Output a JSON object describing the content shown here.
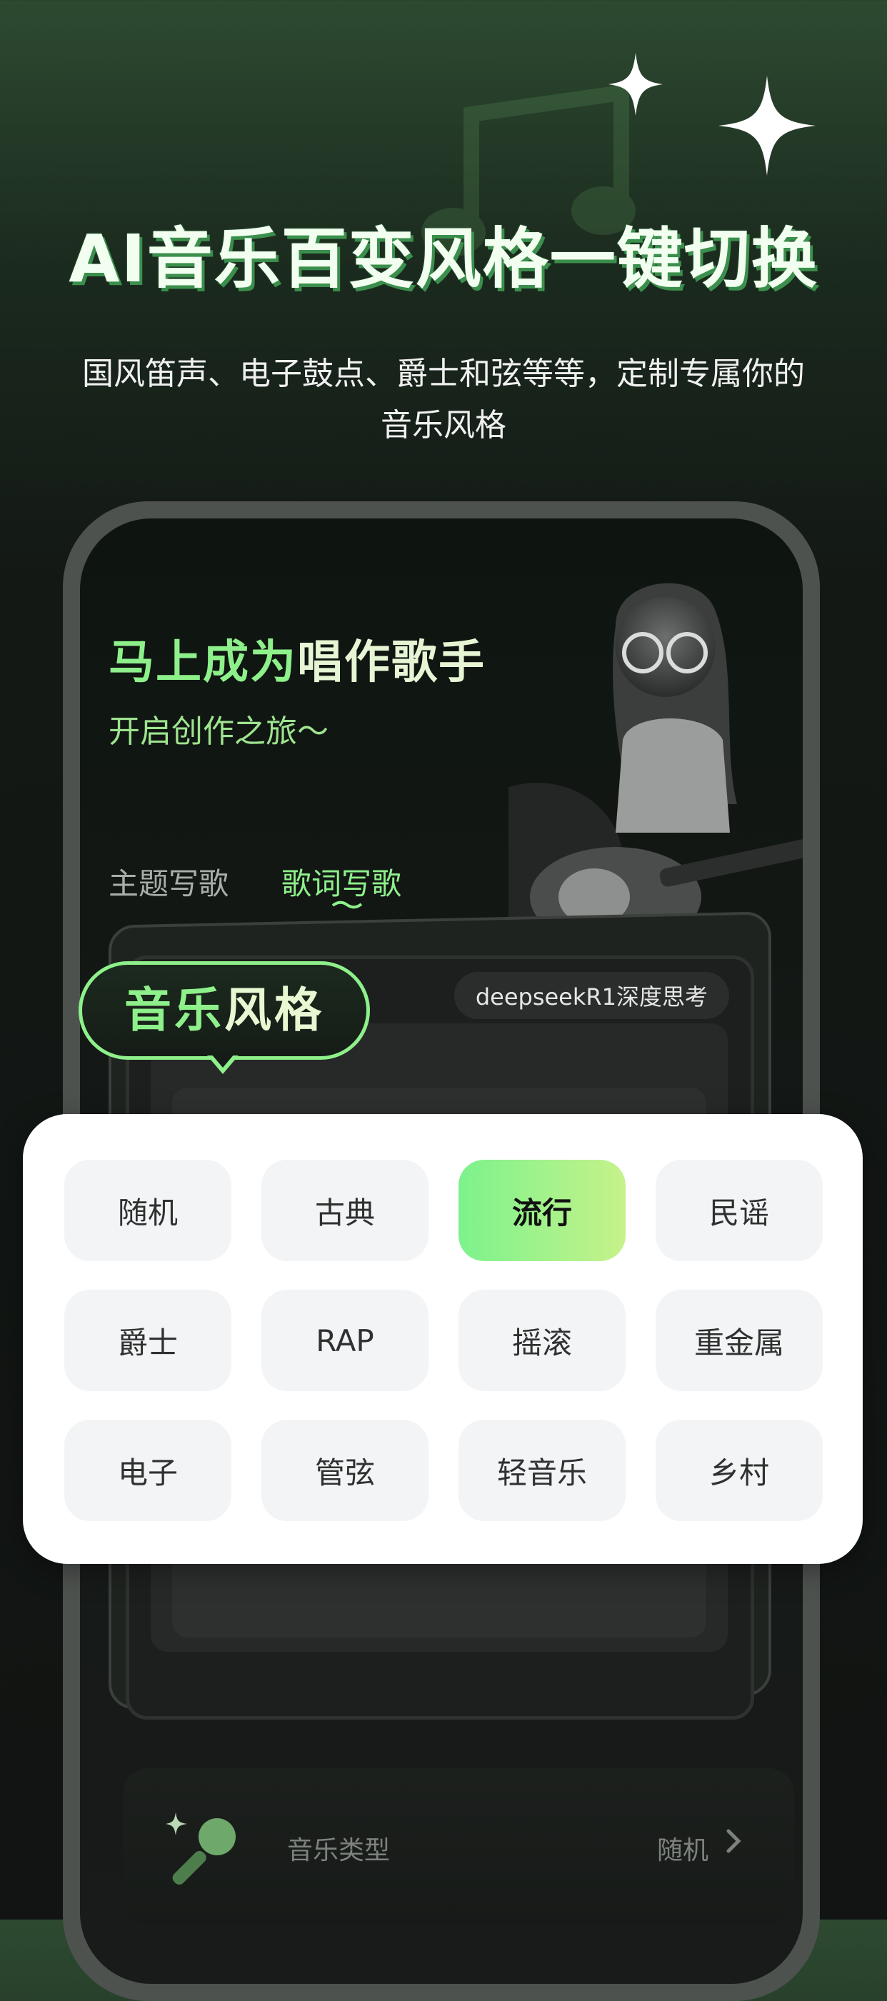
{
  "header": {
    "headline": "AI音乐百变风格一键切换",
    "subtitle_line1": "国风笛声、电子鼓点、爵士和弦等等，定制专属你的",
    "subtitle_line2": "音乐风格"
  },
  "phone": {
    "hero_title_green": "马上成为",
    "hero_title_light": "唱作歌手",
    "hero_subtitle": "开启创作之旅～",
    "tabs": [
      {
        "label": "主题写歌",
        "active": false
      },
      {
        "label": "歌词写歌",
        "active": true
      }
    ],
    "model_pill": "deepseekR1深度思考",
    "bottom_row": {
      "label": "音乐类型",
      "value": "随机"
    }
  },
  "badge": {
    "green": "音乐",
    "light": "风格"
  },
  "styles": {
    "options": [
      "随机",
      "古典",
      "流行",
      "民谣",
      "爵士",
      "RAP",
      "摇滚",
      "重金属",
      "电子",
      "管弦",
      "轻音乐",
      "乡村"
    ],
    "selected": "流行"
  },
  "colors": {
    "accent_green": "#8ef08a",
    "selected_gradient_start": "#7cf28c",
    "selected_gradient_end": "#c7f28a",
    "option_bg": "#f3f4f6"
  }
}
